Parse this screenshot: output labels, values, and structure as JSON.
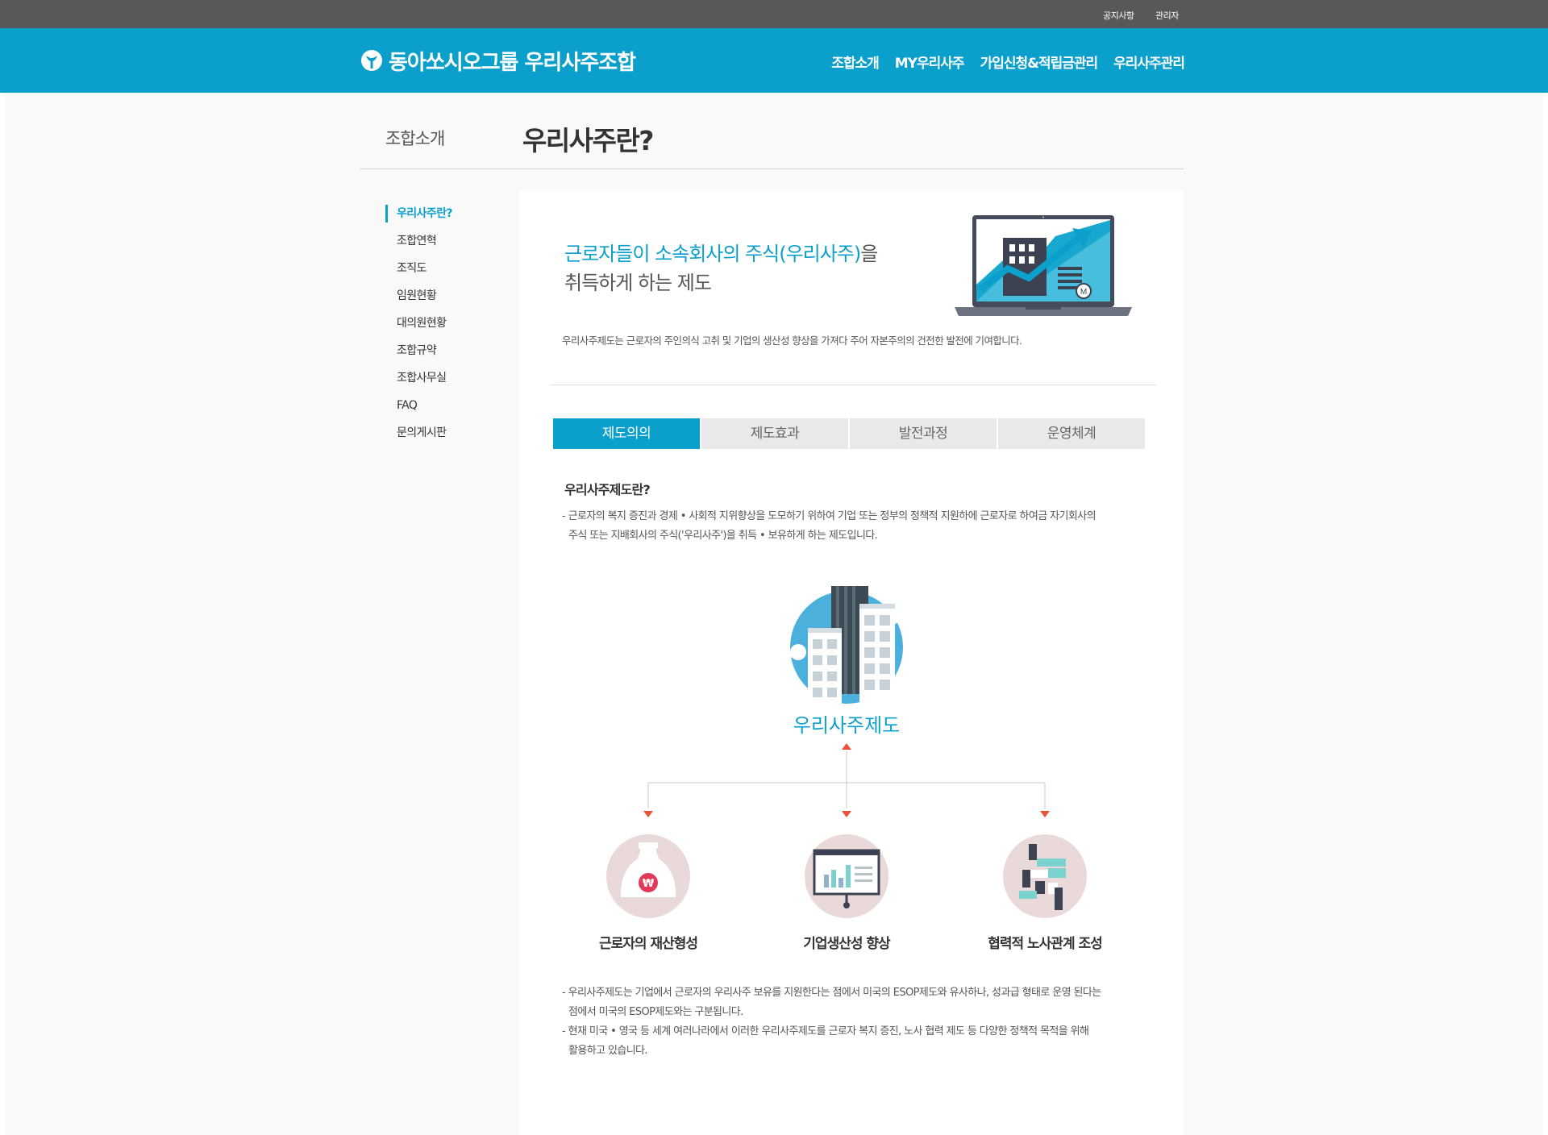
{
  "topbar": {
    "notice": "공지사항",
    "admin": "관리자"
  },
  "header": {
    "brand": "동아쏘시오그룹 우리사주조합",
    "nav": [
      "조합소개",
      "MY우리사주",
      "가입신청&적립금관리",
      "우리사주관리"
    ]
  },
  "page": {
    "section": "조합소개",
    "title": "우리사주란?"
  },
  "lnb": {
    "items": [
      "우리사주란?",
      "조합연혁",
      "조직도",
      "임원현황",
      "대의원현황",
      "조합규약",
      "조합사무실",
      "FAQ",
      "문의게시판"
    ],
    "active": "우리사주란?"
  },
  "lead": {
    "line1_highlight": "근로자들이 소속회사의 주식(우리사주)",
    "line1_rest": "을",
    "line2": "취득하게 하는 제도"
  },
  "intro": "우리사주제도는 근로자의 주인의식 고취 및 기업의 생산성 향상을 가져다 주어 자본주의의 건전한 발전에 기여합니다.",
  "tabs": [
    "제도의의",
    "제도효과",
    "발전과정",
    "운영체계"
  ],
  "active_tab": "제도의의",
  "definition": {
    "title": "우리사주제도란?",
    "line1": "- 근로자의 복지 증진과 경제 • 사회적 지위향상을 도모하기 위하여 기업 또는 정부의 정책적 지원하에 근로자로 하여금 자기회사의",
    "line2": "주식 또는 지배회사의 주식('우리사주')을 취득 • 보유하게 하는 제도입니다."
  },
  "diagram": {
    "center": "우리사주제도",
    "items": [
      "근로자의 재산형성",
      "기업생산성 향상",
      "협력적 노사관계 조성"
    ],
    "won_symbol": "₩"
  },
  "notes": {
    "line1": "- 우리사주제도는 기업에서 근로자의 우리사주 보유를 지원한다는 점에서 미국의 ESOP제도와 유사하나, 성과급 형태로 운영 된다는",
    "line2": "점에서 미국의 ESOP제도와는 구분됩니다.",
    "line3": "- 현재 미국 • 영국 등 세계 여러나라에서 이러한 우리사주제도를 근로자 복지 증진, 노사 협력 제도 등 다양한 정책적 목적을 위해",
    "line4": "활용하고 있습니다."
  },
  "colors": {
    "accent": "#0b9fcc",
    "topbar": "#58585a",
    "arrow": "#e8533a",
    "circle": "#ead9d9"
  }
}
